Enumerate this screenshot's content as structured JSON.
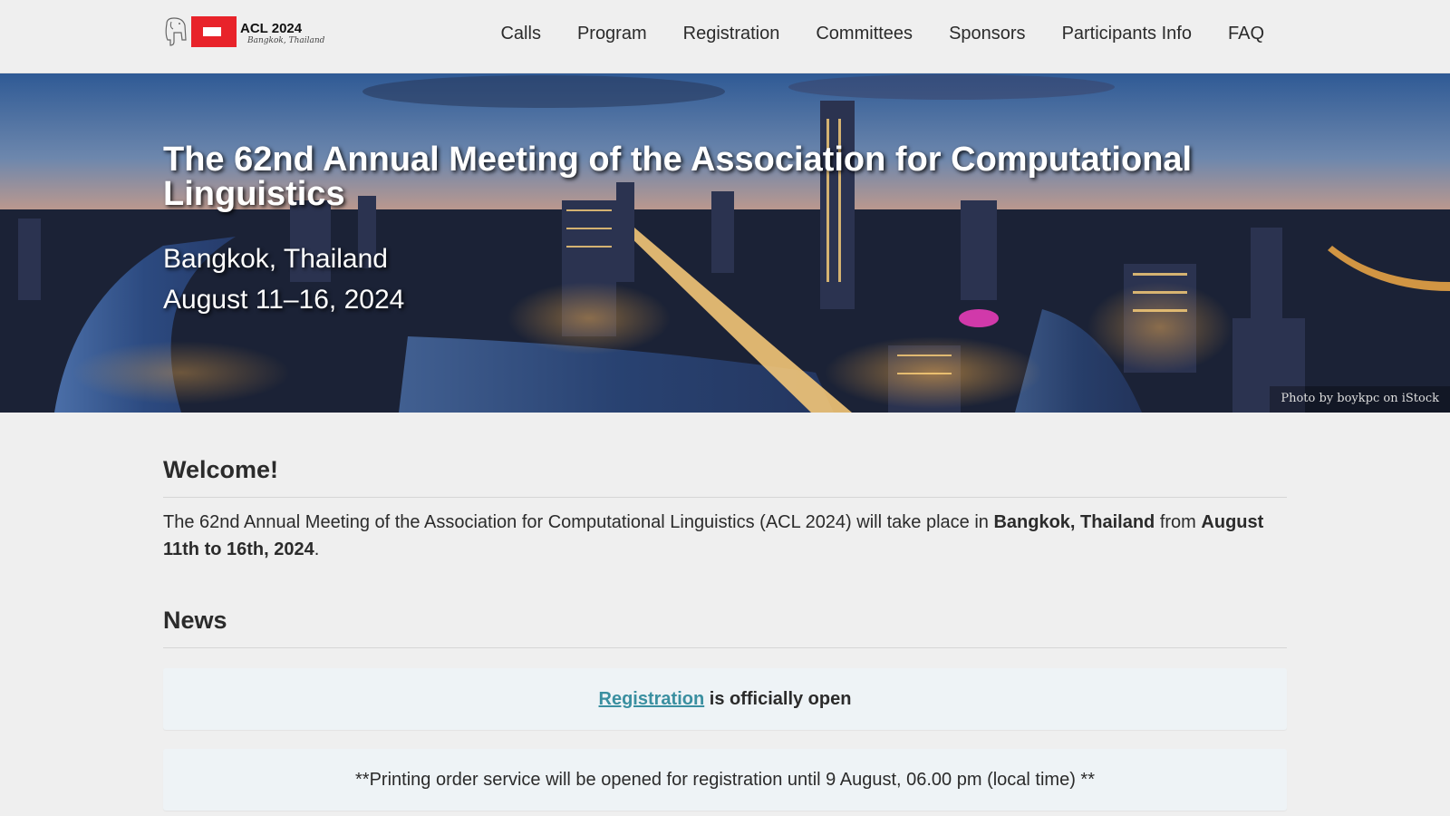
{
  "logo": {
    "title": "ACL 2024",
    "subtitle": "Bangkok, Thailand"
  },
  "nav": {
    "items": [
      "Calls",
      "Program",
      "Registration",
      "Committees",
      "Sponsors",
      "Participants Info",
      "FAQ"
    ]
  },
  "hero": {
    "title": "The 62nd Annual Meeting of the Association for Computational Linguistics",
    "location": "Bangkok, Thailand",
    "dates": "August 11–16, 2024",
    "photo_credit": "Photo by boykpc on iStock"
  },
  "welcome": {
    "heading": "Welcome!",
    "text_before": "The 62nd Annual Meeting of the Association for Computational Linguistics (ACL 2024) will take place in ",
    "location_bold": "Bangkok, Thailand",
    "text_mid": " from ",
    "dates_bold": "August 11th to 16th, 2024",
    "text_end": "."
  },
  "news": {
    "heading": "News",
    "item1_link": "Registration",
    "item1_text": " is officially open",
    "item2_text": "**Printing order service will be opened for registration until 9 August, 06.00 pm (local time) **"
  },
  "colors": {
    "brand_red": "#e8232a",
    "link": "#3a8fa0",
    "news_bg": "#eef3f6"
  }
}
